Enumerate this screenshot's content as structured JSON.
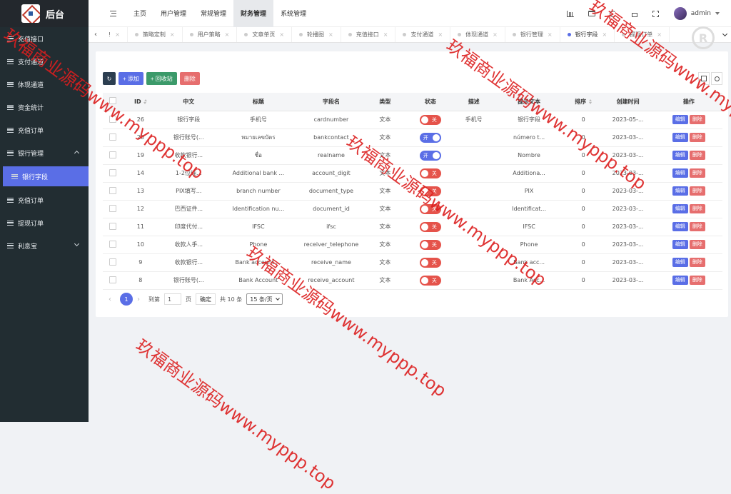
{
  "app": {
    "title": "后台"
  },
  "sidebar": {
    "items": [
      {
        "label": "充值接口",
        "icon": "list-icon"
      },
      {
        "label": "支付通道",
        "icon": "list-icon"
      },
      {
        "label": "体现通道",
        "icon": "list-icon"
      },
      {
        "label": "资金统计",
        "icon": "list-icon"
      },
      {
        "label": "充值订单",
        "icon": "list-icon"
      },
      {
        "label": "银行管理",
        "icon": "list-icon",
        "expanded": true
      },
      {
        "label": "银行字段",
        "icon": "list-icon",
        "active": true
      },
      {
        "label": "充值订单",
        "icon": "list-icon"
      },
      {
        "label": "提现订单",
        "icon": "list-icon"
      },
      {
        "label": "利息宝",
        "icon": "list-icon",
        "expandable": true
      }
    ]
  },
  "topnav": {
    "items": [
      "主页",
      "用户管理",
      "常规管理",
      "财务管理",
      "系统管理"
    ],
    "active": "财务管理",
    "user": "admin"
  },
  "tabs": {
    "first": "!",
    "items": [
      "策略定制",
      "用户策略",
      "文章单页",
      "轮播图",
      "充值接口",
      "支付通道",
      "体现通道",
      "银行管理",
      "银行字段",
      "提现订单"
    ],
    "active": "银行字段"
  },
  "toolbar": {
    "refresh": "",
    "add": "+ 添加",
    "recycle": "+ 回收站",
    "delete": "删除"
  },
  "table": {
    "headers": [
      "ID",
      "中文",
      "标题",
      "字段名",
      "类型",
      "状态",
      "描述",
      "提示文本",
      "排序",
      "创建时间",
      "操作"
    ],
    "rows": [
      {
        "id": "26",
        "cn": "银行字段",
        "title": "手机号",
        "field": "cardnumber",
        "type": "文本",
        "status": "关",
        "desc": "手机号",
        "hint": "银行字段",
        "sort": "0",
        "created": "2023-05-..."
      },
      {
        "id": "20",
        "cn": "银行账号(...",
        "title": "หมายเลขบัตร",
        "field": "bankcontact",
        "type": "文本",
        "status": "开",
        "desc": "",
        "hint": "número t...",
        "sort": "0",
        "created": "2023-03-..."
      },
      {
        "id": "19",
        "cn": "收款银行...",
        "title": "ชื่อ",
        "field": "realname",
        "type": "文本",
        "status": "开",
        "desc": "",
        "hint": "Nombre",
        "sort": "0",
        "created": "2023-03-..."
      },
      {
        "id": "14",
        "cn": "1-2位纯...",
        "title": "Additional bank ...",
        "field": "account_digit",
        "type": "文本",
        "status": "关",
        "desc": "",
        "hint": "Additiona...",
        "sort": "0",
        "created": "2023-03-..."
      },
      {
        "id": "13",
        "cn": "PIX填写...",
        "title": "branch number",
        "field": "document_type",
        "type": "文本",
        "status": "关",
        "desc": "",
        "hint": "PIX",
        "sort": "0",
        "created": "2023-03-..."
      },
      {
        "id": "12",
        "cn": "巴西证件...",
        "title": "Identification nu...",
        "field": "document_id",
        "type": "文本",
        "status": "关",
        "desc": "",
        "hint": "Identificat...",
        "sort": "0",
        "created": "2023-03-..."
      },
      {
        "id": "11",
        "cn": "印度代付...",
        "title": "IFSC",
        "field": "ifsc",
        "type": "文本",
        "status": "关",
        "desc": "",
        "hint": "IFSC",
        "sort": "0",
        "created": "2023-03-..."
      },
      {
        "id": "10",
        "cn": "收款人手...",
        "title": "Phone",
        "field": "receiver_telephone",
        "type": "文本",
        "status": "关",
        "desc": "",
        "hint": "Phone",
        "sort": "0",
        "created": "2023-03-..."
      },
      {
        "id": "9",
        "cn": "收款银行...",
        "title": "Bank account ...",
        "field": "receive_name",
        "type": "文本",
        "status": "关",
        "desc": "",
        "hint": "Bank acc...",
        "sort": "0",
        "created": "2023-03-..."
      },
      {
        "id": "8",
        "cn": "银行账号(...",
        "title": "Bank Account",
        "field": "receive_account",
        "type": "文本",
        "status": "关",
        "desc": "",
        "hint": "Bank Acc...",
        "sort": "0",
        "created": "2023-03-..."
      }
    ],
    "edit_label": "编辑",
    "delete_label": "删除"
  },
  "pager": {
    "current": "1",
    "goto_label": "到第",
    "page_input": "1",
    "page_label": "页",
    "confirm": "确定",
    "total": "共 10 条",
    "per_page": "15 条/页"
  },
  "watermark": {
    "text": "玖福商业源码www.myppp.top",
    "color": "#dc1e1e"
  }
}
